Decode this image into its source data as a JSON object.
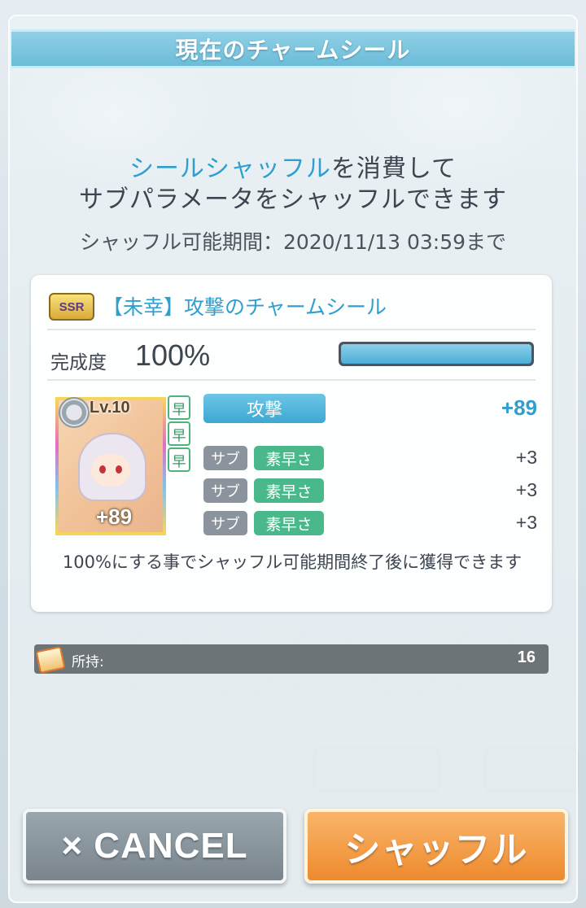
{
  "header": {
    "title": "現在のチャームシール"
  },
  "intro": {
    "highlight": "シールシャッフル",
    "line1_rest": "を消費して",
    "line2": "サブパラメータをシャッフルできます"
  },
  "period": "シャッフル可能期間：2020/11/13 03:59まで",
  "seal": {
    "rarity": "SSR",
    "name": "【未幸】攻撃のチャームシール",
    "completion_label": "完成度",
    "completion_value": "100%",
    "completion_progress": 1.0,
    "level": "Lv.10",
    "attack_overlay": "+89",
    "speed_tags": [
      "早",
      "早",
      "早"
    ],
    "main_stat": {
      "label": "攻撃",
      "value": "+89"
    },
    "sub_stats": [
      {
        "tag": "サブ",
        "label": "素早さ",
        "value": "+3"
      },
      {
        "tag": "サブ",
        "label": "素早さ",
        "value": "+3"
      },
      {
        "tag": "サブ",
        "label": "素早さ",
        "value": "+3"
      }
    ],
    "note": "100%にする事でシャッフル可能期間終了後に獲得できます"
  },
  "owned": {
    "label": "所持:",
    "value": "16"
  },
  "buttons": {
    "cancel": "× CANCEL",
    "shuffle": "シャッフル"
  },
  "colors": {
    "accent_blue": "#2f9fd0",
    "main_stat_bg": "#3ea8d2",
    "sub_stat_bg": "#49b88a",
    "shuffle_button": "#ee8a2e",
    "cancel_button": "#79848c"
  }
}
